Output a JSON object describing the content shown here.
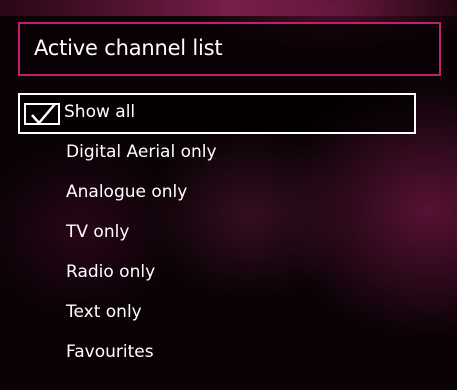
{
  "title": "Active channel list",
  "menu": {
    "items": [
      {
        "label": "Show all",
        "checked": true,
        "selected": true
      },
      {
        "label": "Digital Aerial only",
        "checked": false,
        "selected": false
      },
      {
        "label": "Analogue only",
        "checked": false,
        "selected": false
      },
      {
        "label": "TV only",
        "checked": false,
        "selected": false
      },
      {
        "label": "Radio only",
        "checked": false,
        "selected": false
      },
      {
        "label": "Text only",
        "checked": false,
        "selected": false
      },
      {
        "label": "Favourites",
        "checked": false,
        "selected": false
      }
    ]
  },
  "colors": {
    "title_border": "#c0206e",
    "selection_border": "#ffffff",
    "text": "#ffffff"
  },
  "icons": {
    "checkbox": "check-icon"
  }
}
